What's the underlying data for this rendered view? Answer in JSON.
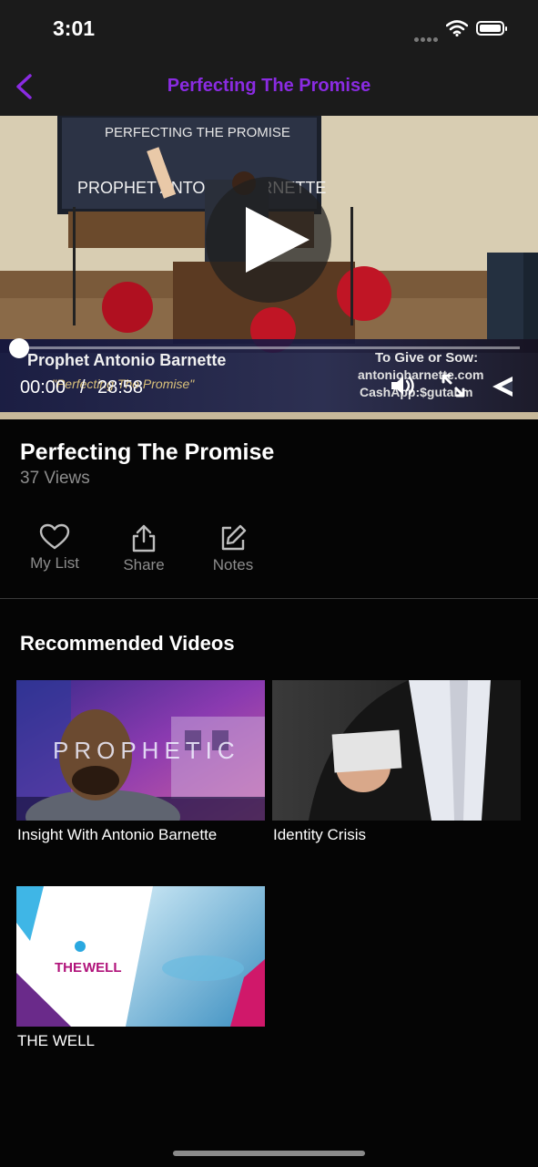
{
  "status_bar": {
    "time": "3:01"
  },
  "nav": {
    "title": "Perfecting The Promise",
    "back_icon": "chevron-left-icon",
    "accent": "#8a2be2"
  },
  "player": {
    "screen_text_line1": "PERFECTING THE PROMISE",
    "screen_text_line2": "PROPHET ANTONIO BARNETTE",
    "lower_third_name": "Prophet Antonio Barnette",
    "lower_third_subtitle": "\"Perfecting The Promise\"",
    "lower_third_give": "To Give or Sow:",
    "lower_third_site": "antoniobarnette.com",
    "lower_third_cash": "CashApp:$gutabm",
    "current_time": "00:00",
    "separator": "/",
    "duration": "28:58",
    "progress": 0
  },
  "video": {
    "title": "Perfecting The Promise",
    "views": "37 Views"
  },
  "actions": [
    {
      "label": "My List",
      "icon": "heart-icon"
    },
    {
      "label": "Share",
      "icon": "share-icon"
    },
    {
      "label": "Notes",
      "icon": "edit-icon"
    }
  ],
  "recommended": {
    "heading": "Recommended Videos",
    "items": [
      {
        "title": "Insight With Antonio Barnette",
        "thumb_text": "PROPHETIC"
      },
      {
        "title": "Identity Crisis"
      },
      {
        "title": "THE WELL",
        "thumb_text_the": "THE",
        "thumb_text_well": "WELL"
      }
    ]
  }
}
